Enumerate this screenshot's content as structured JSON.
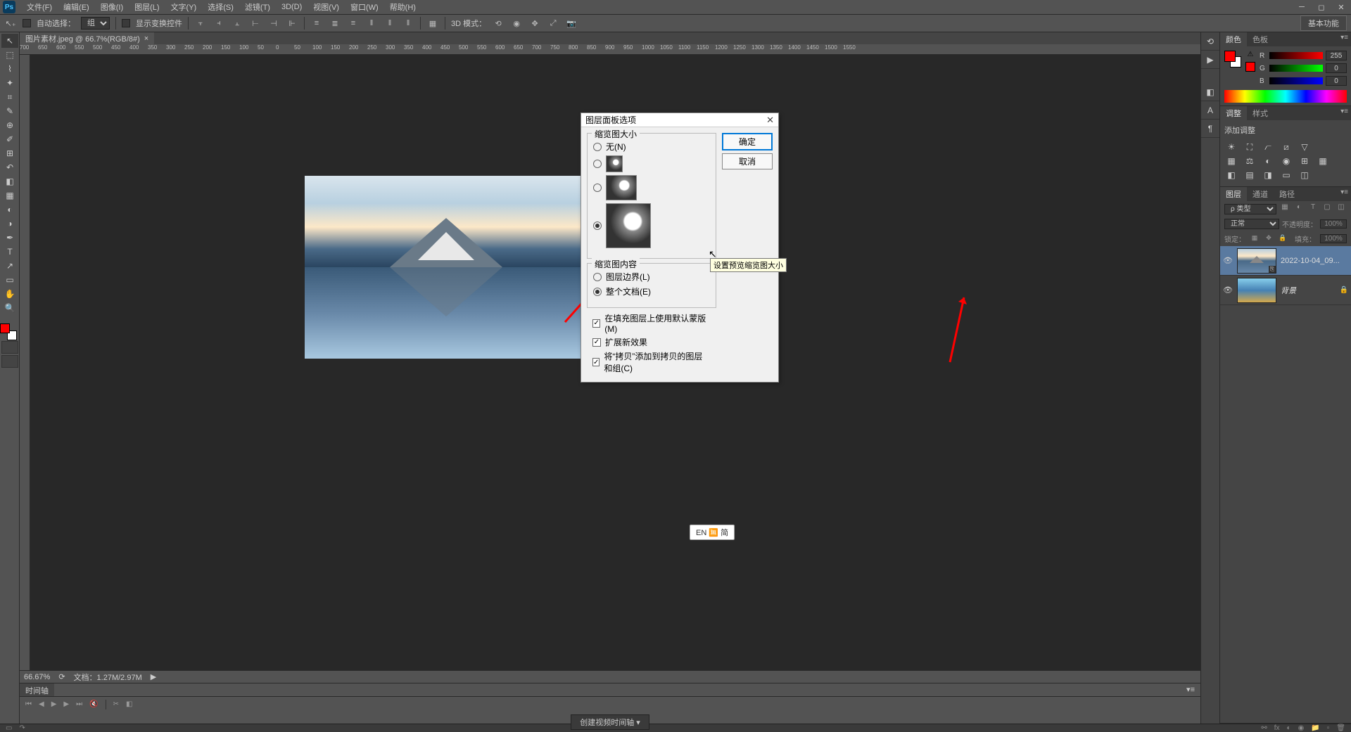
{
  "menu": {
    "items": [
      "文件(F)",
      "编辑(E)",
      "图像(I)",
      "图层(L)",
      "文字(Y)",
      "选择(S)",
      "滤镜(T)",
      "3D(D)",
      "视图(V)",
      "窗口(W)",
      "帮助(H)"
    ]
  },
  "options": {
    "auto_select_label": "自动选择：",
    "auto_select_value": "组",
    "show_transform": "显示变换控件",
    "mode_3d": "3D 模式：",
    "essentials": "基本功能"
  },
  "tab": {
    "title": "图片素材.jpeg @ 66.7%(RGB/8#)"
  },
  "ruler": {
    "marks": [
      "700",
      "650",
      "600",
      "550",
      "500",
      "450",
      "400",
      "350",
      "300",
      "250",
      "200",
      "150",
      "100",
      "50",
      "0",
      "50",
      "100",
      "150",
      "200",
      "250",
      "300",
      "350",
      "400",
      "450",
      "500",
      "550",
      "600",
      "650",
      "700",
      "750",
      "800",
      "850",
      "900",
      "950",
      "1000",
      "1050",
      "1100",
      "1150",
      "1200",
      "1250",
      "1300",
      "1350",
      "1400",
      "1450",
      "1500",
      "1550"
    ]
  },
  "status": {
    "zoom": "66.67%",
    "docinfo": "文档：1.27M/2.97M"
  },
  "timeline": {
    "tab": "时间轴",
    "create": "创建视频时间轴"
  },
  "panels": {
    "color": {
      "tab1": "颜色",
      "tab2": "色板",
      "r": "R",
      "g": "G",
      "b": "B",
      "rv": "255",
      "gv": "0",
      "bv": "0"
    },
    "adjustments": {
      "tab1": "调整",
      "tab2": "样式",
      "title": "添加调整"
    },
    "layers": {
      "tab1": "图层",
      "tab2": "通道",
      "tab3": "路径",
      "filter_kind": "ρ 类型",
      "mode": "正常",
      "opacity_label": "不透明度：",
      "opacity_value": "100%",
      "lock_label": "锁定：",
      "fill_label": "填充：",
      "fill_value": "100%",
      "items": [
        {
          "name": "2022-10-04_09..."
        },
        {
          "name": "背景"
        }
      ]
    }
  },
  "dialog": {
    "title": "图层面板选项",
    "ok": "确定",
    "cancel": "取消",
    "group1_legend": "缩览图大小",
    "none_label": "无(N)",
    "group2_legend": "缩览图内容",
    "bounds_label": "图层边界(L)",
    "doc_label": "整个文档(E)",
    "chk1": "在填充图层上使用默认蒙版(M)",
    "chk2": "扩展新效果",
    "chk3": "将“拷贝”添加到拷贝的图层和组(C)",
    "tooltip": "设置预览缩览图大小"
  },
  "ime": "EN 🈚 简"
}
